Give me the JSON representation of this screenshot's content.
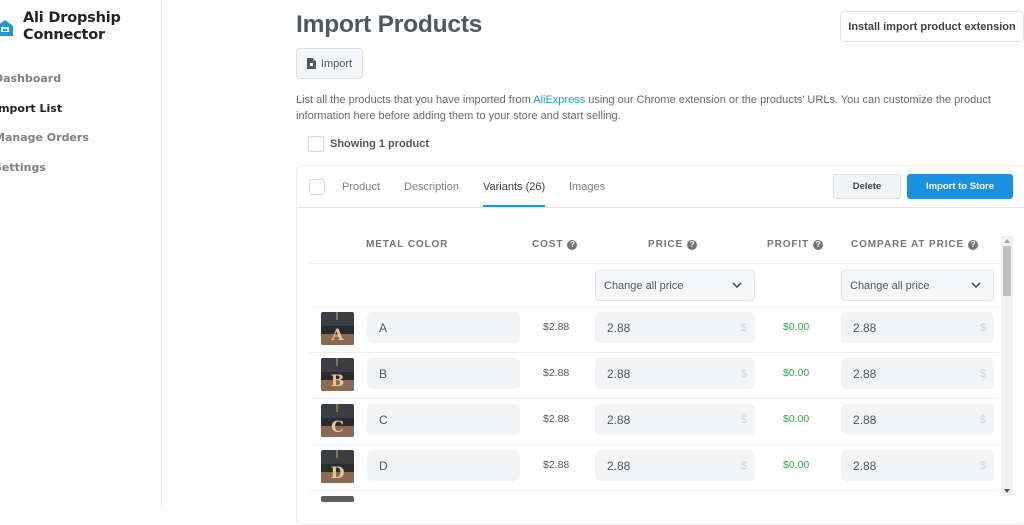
{
  "sidebar": {
    "brand_line1": "Ali Dropship",
    "brand_line2": "Connector",
    "brand_icon": "store-icon",
    "items": [
      {
        "label": "Dashboard",
        "active": false
      },
      {
        "label": "Import List",
        "active": true
      },
      {
        "label": "Manage Orders",
        "active": false
      },
      {
        "label": "Settings",
        "active": false
      }
    ]
  },
  "header": {
    "title": "Import Products",
    "install_button": "Install import product extension",
    "import_button": "Import",
    "import_icon": "file-import-icon"
  },
  "description": {
    "before_link": "List all the products that you have imported from ",
    "link": "AliExpress",
    "after_link": " using our Chrome extension or the products' URLs. You can customize the product information here before adding them to your store and start selling."
  },
  "showing_label": "Showing 1 product",
  "product_card": {
    "tabs": [
      {
        "label": "Product",
        "active": false
      },
      {
        "label": "Description",
        "active": false
      },
      {
        "label": "Variants (26)",
        "active": true
      },
      {
        "label": "Images",
        "active": false
      }
    ],
    "delete_button": "Delete",
    "import_to_store_button": "Import to Store",
    "accent_color": "#1a90e0",
    "columns": {
      "metal_color": "METAL COLOR",
      "cost": "COST",
      "price": "PRICE",
      "profit": "PROFIT",
      "compare_at_price": "COMPARE AT PRICE"
    },
    "help_icon_glyph": "?",
    "change_price_select": "Change all price",
    "change_compare_select": "Change all price",
    "currency_suffix": "$",
    "variants": [
      {
        "name": "A",
        "cost": "$2.88",
        "price": "2.88",
        "profit": "$0.00",
        "compare_at_price": "2.88"
      },
      {
        "name": "B",
        "cost": "$2.88",
        "price": "2.88",
        "profit": "$0.00",
        "compare_at_price": "2.88"
      },
      {
        "name": "C",
        "cost": "$2.88",
        "price": "2.88",
        "profit": "$0.00",
        "compare_at_price": "2.88"
      },
      {
        "name": "D",
        "cost": "$2.88",
        "price": "2.88",
        "profit": "$0.00",
        "compare_at_price": "2.88"
      }
    ]
  }
}
